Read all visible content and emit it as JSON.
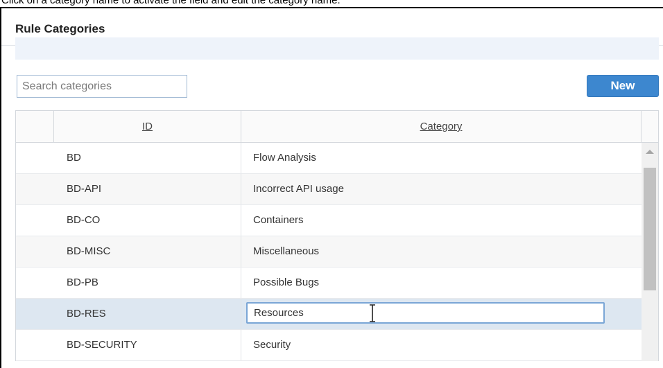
{
  "instruction": "Click on a category name to activate the field and edit the category name.",
  "panel": {
    "title": "Rule Categories"
  },
  "search": {
    "placeholder": "Search categories",
    "value": ""
  },
  "new_button": {
    "label": "New"
  },
  "table": {
    "headers": {
      "id": "ID",
      "category": "Category"
    },
    "rows": [
      {
        "id": "BD",
        "category": "Flow Analysis"
      },
      {
        "id": "BD-API",
        "category": "Incorrect API usage"
      },
      {
        "id": "BD-CO",
        "category": "Containers"
      },
      {
        "id": "BD-MISC",
        "category": "Miscellaneous"
      },
      {
        "id": "BD-PB",
        "category": "Possible Bugs"
      },
      {
        "id": "BD-RES",
        "category": "Resources"
      },
      {
        "id": "BD-SECURITY",
        "category": "Security"
      }
    ],
    "selected_row_index": 5,
    "editing_value": "Resources"
  },
  "colors": {
    "accent": "#3d87cf",
    "selected_row": "#dde7f1",
    "header_band": "#eef3fa"
  }
}
